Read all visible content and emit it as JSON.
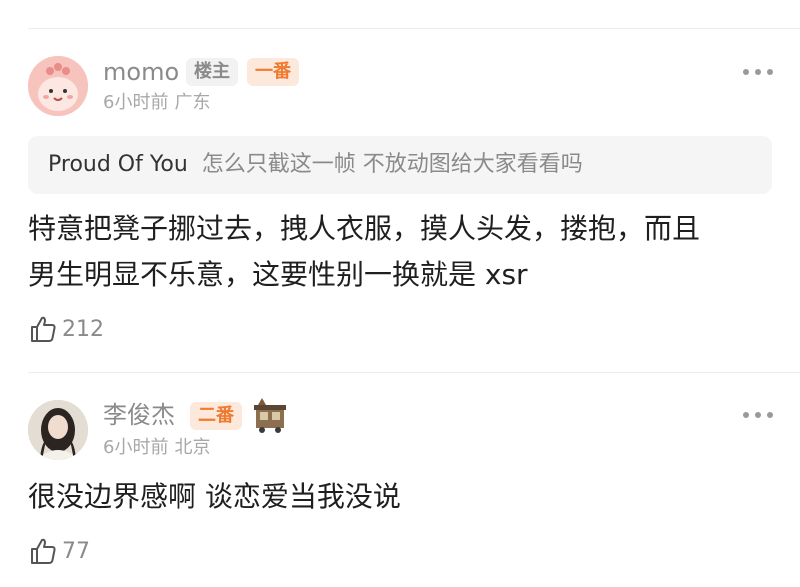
{
  "comments": [
    {
      "username": "momo",
      "owner_badge": "楼主",
      "floor_badge": "一番",
      "time": "6小时前",
      "location": "广东",
      "quote": {
        "author": "Proud Of You",
        "text": "怎么只截这一帧  不放动图给大家看看吗"
      },
      "lines": [
        "特意把凳子挪过去，拽人衣服，摸人头发，搂抱，而且",
        "男生明显不乐意，这要性别一换就是 xsr"
      ],
      "likes": "212"
    },
    {
      "username": "李俊杰",
      "floor_badge": "二番",
      "time": "6小时前",
      "location": "北京",
      "lines": [
        "很没边界感啊 谈恋爱当我没说"
      ],
      "likes": "77"
    }
  ],
  "colors": {
    "floor_badge_bg": "#fde9dc",
    "floor_badge_text": "#f07a2f",
    "owner_badge_bg": "#f2f2f2"
  }
}
